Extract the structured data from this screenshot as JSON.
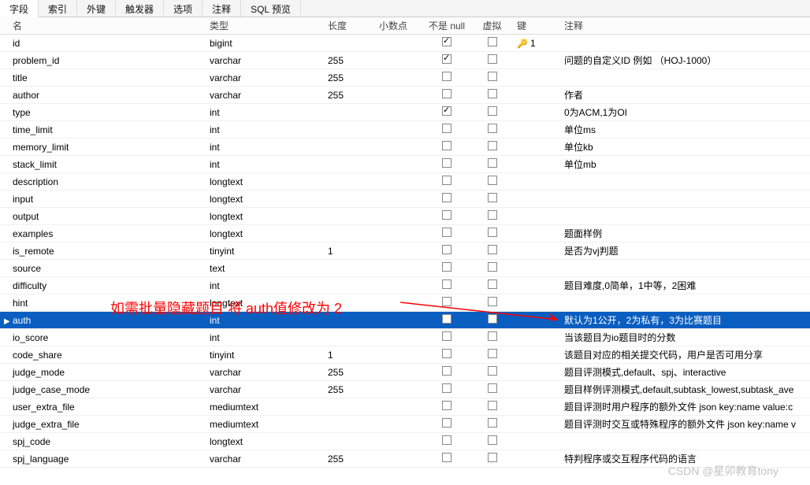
{
  "tabs": [
    "字段",
    "索引",
    "外键",
    "触发器",
    "选项",
    "注释",
    "SQL 预览"
  ],
  "activeTab": 0,
  "headers": {
    "name": "名",
    "type": "类型",
    "length": "长度",
    "decimal": "小数点",
    "notnull": "不是 null",
    "virtual": "虚拟",
    "key": "键",
    "comment": "注释"
  },
  "rows": [
    {
      "name": "id",
      "type": "bigint",
      "len": "",
      "dec": "",
      "nn": true,
      "v": false,
      "key": "1",
      "comment": "",
      "sel": false
    },
    {
      "name": "problem_id",
      "type": "varchar",
      "len": "255",
      "dec": "",
      "nn": true,
      "v": false,
      "key": "",
      "comment": "问题的自定义ID 例如 （HOJ-1000）",
      "sel": false
    },
    {
      "name": "title",
      "type": "varchar",
      "len": "255",
      "dec": "",
      "nn": false,
      "v": false,
      "key": "",
      "comment": "",
      "sel": false
    },
    {
      "name": "author",
      "type": "varchar",
      "len": "255",
      "dec": "",
      "nn": false,
      "v": false,
      "key": "",
      "comment": "作者",
      "sel": false
    },
    {
      "name": "type",
      "type": "int",
      "len": "",
      "dec": "",
      "nn": true,
      "v": false,
      "key": "",
      "comment": "0为ACM,1为OI",
      "sel": false
    },
    {
      "name": "time_limit",
      "type": "int",
      "len": "",
      "dec": "",
      "nn": false,
      "v": false,
      "key": "",
      "comment": "单位ms",
      "sel": false
    },
    {
      "name": "memory_limit",
      "type": "int",
      "len": "",
      "dec": "",
      "nn": false,
      "v": false,
      "key": "",
      "comment": "单位kb",
      "sel": false
    },
    {
      "name": "stack_limit",
      "type": "int",
      "len": "",
      "dec": "",
      "nn": false,
      "v": false,
      "key": "",
      "comment": "单位mb",
      "sel": false
    },
    {
      "name": "description",
      "type": "longtext",
      "len": "",
      "dec": "",
      "nn": false,
      "v": false,
      "key": "",
      "comment": "",
      "sel": false
    },
    {
      "name": "input",
      "type": "longtext",
      "len": "",
      "dec": "",
      "nn": false,
      "v": false,
      "key": "",
      "comment": "",
      "sel": false
    },
    {
      "name": "output",
      "type": "longtext",
      "len": "",
      "dec": "",
      "nn": false,
      "v": false,
      "key": "",
      "comment": "",
      "sel": false
    },
    {
      "name": "examples",
      "type": "longtext",
      "len": "",
      "dec": "",
      "nn": false,
      "v": false,
      "key": "",
      "comment": "题面样例",
      "sel": false
    },
    {
      "name": "is_remote",
      "type": "tinyint",
      "len": "1",
      "dec": "",
      "nn": false,
      "v": false,
      "key": "",
      "comment": "是否为vj判题",
      "sel": false
    },
    {
      "name": "source",
      "type": "text",
      "len": "",
      "dec": "",
      "nn": false,
      "v": false,
      "key": "",
      "comment": "",
      "sel": false
    },
    {
      "name": "difficulty",
      "type": "int",
      "len": "",
      "dec": "",
      "nn": false,
      "v": false,
      "key": "",
      "comment": "题目难度,0简单，1中等，2困难",
      "sel": false
    },
    {
      "name": "hint",
      "type": "longtext",
      "len": "",
      "dec": "",
      "nn": false,
      "v": false,
      "key": "",
      "comment": "",
      "sel": false
    },
    {
      "name": "auth",
      "type": "int",
      "len": "",
      "dec": "",
      "nn": false,
      "v": false,
      "key": "",
      "comment": "默认为1公开，2为私有，3为比赛题目",
      "sel": true
    },
    {
      "name": "io_score",
      "type": "int",
      "len": "",
      "dec": "",
      "nn": false,
      "v": false,
      "key": "",
      "comment": "当该题目为io题目时的分数",
      "sel": false
    },
    {
      "name": "code_share",
      "type": "tinyint",
      "len": "1",
      "dec": "",
      "nn": false,
      "v": false,
      "key": "",
      "comment": "该题目对应的相关提交代码，用户是否可用分享",
      "sel": false
    },
    {
      "name": "judge_mode",
      "type": "varchar",
      "len": "255",
      "dec": "",
      "nn": false,
      "v": false,
      "key": "",
      "comment": "题目评测模式,default、spj、interactive",
      "sel": false
    },
    {
      "name": "judge_case_mode",
      "type": "varchar",
      "len": "255",
      "dec": "",
      "nn": false,
      "v": false,
      "key": "",
      "comment": "题目样例评测模式,default,subtask_lowest,subtask_ave",
      "sel": false
    },
    {
      "name": "user_extra_file",
      "type": "mediumtext",
      "len": "",
      "dec": "",
      "nn": false,
      "v": false,
      "key": "",
      "comment": "题目评测时用户程序的额外文件 json key:name value:c",
      "sel": false
    },
    {
      "name": "judge_extra_file",
      "type": "mediumtext",
      "len": "",
      "dec": "",
      "nn": false,
      "v": false,
      "key": "",
      "comment": "题目评测时交互或特殊程序的额外文件 json key:name v",
      "sel": false
    },
    {
      "name": "spj_code",
      "type": "longtext",
      "len": "",
      "dec": "",
      "nn": false,
      "v": false,
      "key": "",
      "comment": "",
      "sel": false
    },
    {
      "name": "spj_language",
      "type": "varchar",
      "len": "255",
      "dec": "",
      "nn": false,
      "v": false,
      "key": "",
      "comment": "特判程序或交互程序代码的语言",
      "sel": false
    }
  ],
  "annotation": "如需批量隐藏题目 将 auth值修改为 2",
  "watermark": "CSDN @星卯教育tony"
}
